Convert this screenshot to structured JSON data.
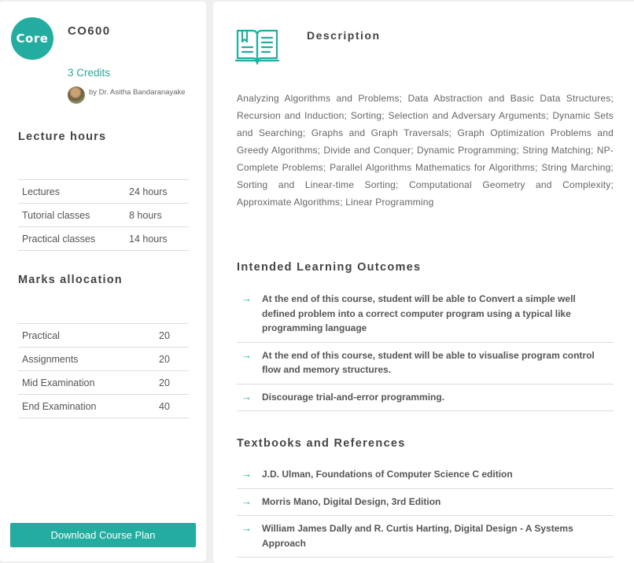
{
  "course": {
    "badge": "Core",
    "code": "CO600",
    "credits": "3 Credits",
    "lecturer": "by Dr. Asitha Bandaranayake"
  },
  "lecture_hours": {
    "title": "Lecture hours",
    "rows": [
      {
        "label": "Lectures",
        "value": "24 hours"
      },
      {
        "label": "Tutorial classes",
        "value": "8 hours"
      },
      {
        "label": "Practical classes",
        "value": "14 hours"
      }
    ]
  },
  "marks": {
    "title": "Marks allocation",
    "rows": [
      {
        "label": "Practical",
        "value": "20"
      },
      {
        "label": "Assignments",
        "value": "20"
      },
      {
        "label": "Mid Examination",
        "value": "20"
      },
      {
        "label": "End Examination",
        "value": "40"
      }
    ]
  },
  "download_label": "Download Course Plan",
  "description": {
    "title": "Description",
    "text": "Analyzing Algorithms and Problems; Data Abstraction and Basic Data Structures; Recursion and Induction; Sorting; Selection and Adversary Arguments; Dynamic Sets and Searching; Graphs and Graph Traversals; Graph Optimization Problems and Greedy Algorithms; Divide and Conquer; Dynamic Programming; String Matching; NP-Complete Problems; Parallel Algorithms Mathematics for Algorithms; String Marching; Sorting and Linear-time Sorting; Computational Geometry and Complexity; Approximate Algorithms; Linear Programming"
  },
  "outcomes": {
    "title": "Intended Learning Outcomes",
    "items": [
      "At the end of this course, student will be able to Convert a simple well defined problem into a correct computer program using a typical like programming language",
      "At the end of this course, student will be able to visualise program control flow and memory structures.",
      "Discourage trial-and-error programming."
    ]
  },
  "textbooks": {
    "title": "Textbooks and References",
    "items": [
      "J.D. Ulman, Foundations of Computer Science C edition",
      "Morris Mano, Digital Design, 3rd Edition",
      "William James Dally and R. Curtis Harting, Digital Design - A Systems Approach"
    ]
  },
  "icons": {
    "list_bullet": "arrow-right-icon",
    "description": "open-book-icon"
  },
  "colors": {
    "accent": "#23ada0",
    "heading": "#444444"
  }
}
